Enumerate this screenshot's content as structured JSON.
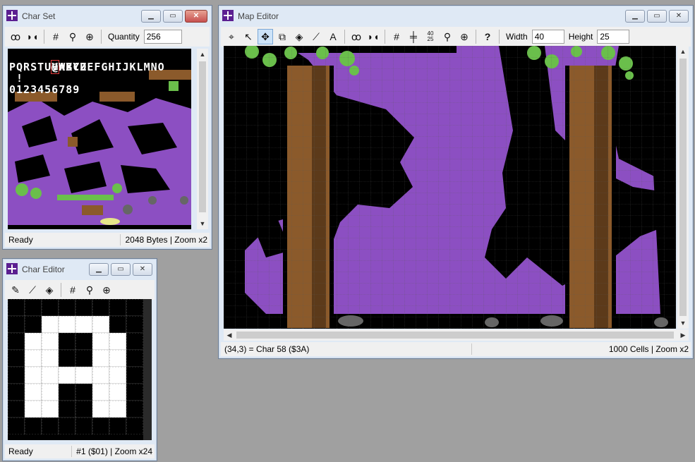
{
  "charset": {
    "title": "Char Set",
    "quantity_label": "Quantity",
    "quantity_value": "256",
    "status_left": "Ready",
    "status_right": "2048 Bytes | Zoom x2",
    "rows": [
      "ABCDEFGHIJKLMNO",
      "PQRSTUVWXYZ",
      " !",
      "0123456789"
    ],
    "first_glyph": "@"
  },
  "chareditor": {
    "title": "Char Editor",
    "status_left": "Ready",
    "status_right": "#1 ($01) | Zoom x24",
    "pixels": [
      "00000000",
      "00111100",
      "01100110",
      "01100110",
      "01111110",
      "01100110",
      "01100110",
      "00000000"
    ]
  },
  "mapeditor": {
    "title": "Map Editor",
    "width_label": "Width",
    "width_value": "40",
    "height_label": "Height",
    "height_value": "25",
    "status_left": "(34,3) = Char 58 ($3A)",
    "status_right": "1000 Cells | Zoom x2",
    "grid_num_icon": "40 25"
  },
  "colors": {
    "purple": "#8c4fc2",
    "brown": "#8b5a2b",
    "green": "#6abf4b",
    "black": "#000000"
  }
}
